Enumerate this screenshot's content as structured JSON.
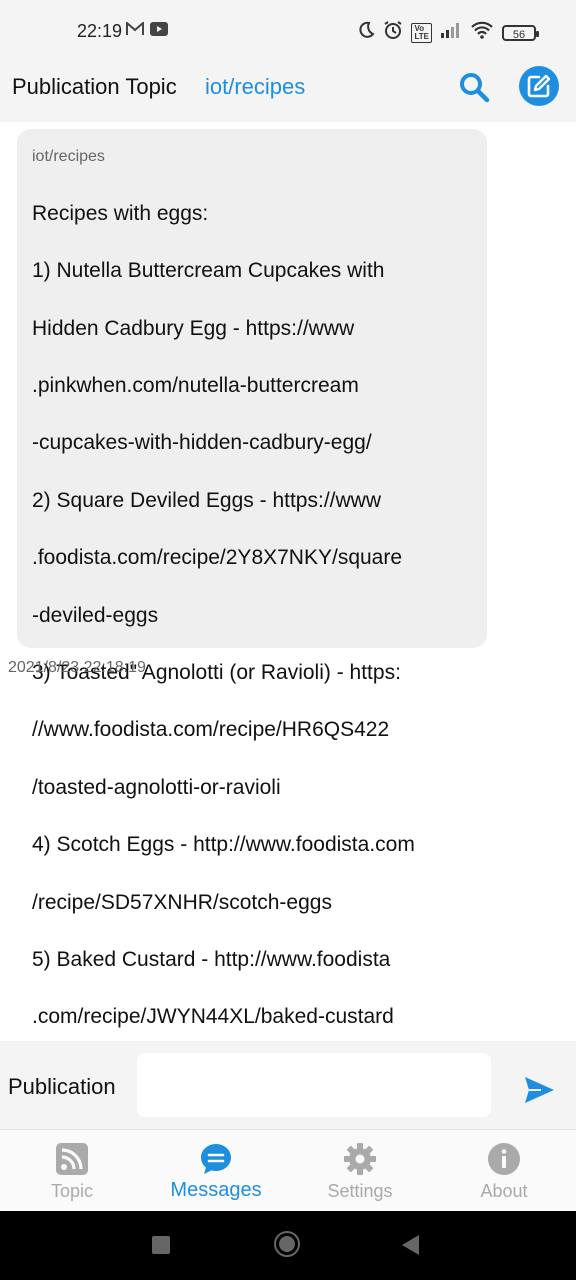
{
  "status_bar": {
    "time": "22:19",
    "battery": "56",
    "volte": "Vo LTE",
    "icons": [
      "gmail-icon",
      "youtube-icon",
      "moon-icon",
      "alarm-icon",
      "volte-icon",
      "signal-icon",
      "wifi-icon",
      "battery-icon"
    ]
  },
  "header": {
    "label": "Publication Topic",
    "topic": "iot/recipes",
    "accent_color": "#1e8fe0",
    "icons": [
      "search-icon",
      "edit-icon"
    ]
  },
  "message": {
    "topic": "iot/recipes",
    "lines": [
      "Recipes with eggs:",
      "1) Nutella Buttercream Cupcakes with",
      "Hidden Cadbury Egg - https://www",
      ".pinkwhen.com/nutella-buttercream",
      "-cupcakes-with-hidden-cadbury-egg/",
      "2) Square Deviled Eggs - https://www",
      ".foodista.com/recipe/2Y8X7NKY/square",
      "-deviled-eggs",
      "3) Toasted\" Agnolotti (or Ravioli) - https:",
      "//www.foodista.com/recipe/HR6QS422",
      "/toasted-agnolotti-or-ravioli",
      "4) Scotch Eggs - http://www.foodista.com",
      "/recipe/SD57XNHR/scotch-eggs",
      "5) Baked Custard - http://www.foodista",
      ".com/recipe/JWYN44XL/baked-custard"
    ],
    "timestamp": "2021/8/23 22:18:19"
  },
  "publication": {
    "label": "Publication",
    "value": "",
    "placeholder": ""
  },
  "bottom_nav": {
    "items": [
      {
        "label": "Topic",
        "icon": "rss-icon",
        "active": false
      },
      {
        "label": "Messages",
        "icon": "chat-bubble-icon",
        "active": true
      },
      {
        "label": "Settings",
        "icon": "gear-icon",
        "active": false
      },
      {
        "label": "About",
        "icon": "info-icon",
        "active": false
      }
    ]
  },
  "system_nav": {
    "icons": [
      "recents-icon",
      "home-icon",
      "back-icon"
    ]
  }
}
